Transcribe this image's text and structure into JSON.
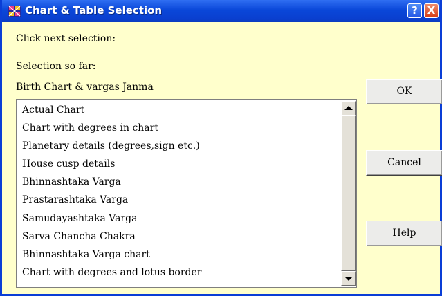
{
  "window": {
    "title": "Chart & Table Selection",
    "help_button": "?",
    "close_button": "X",
    "title_bar_color": "#0a47d9",
    "background_color": "#ffffcc"
  },
  "labels": {
    "prompt": "Click next selection:",
    "selection_so_far": "Selection so far:",
    "selection_value": "Birth Chart & vargas Janma"
  },
  "list": {
    "items": [
      "Actual Chart",
      "Chart with degrees in chart",
      "Planetary details (degrees,sign etc.)",
      "House cusp details",
      "Bhinnashtaka Varga",
      "Prastarashtaka Varga",
      "Samudayashtaka Varga",
      "Sarva Chancha Chakra",
      "Bhinnashtaka Varga chart",
      "Chart with degrees and lotus border"
    ]
  },
  "buttons": {
    "ok": "OK",
    "cancel": "Cancel",
    "help": "Help"
  }
}
